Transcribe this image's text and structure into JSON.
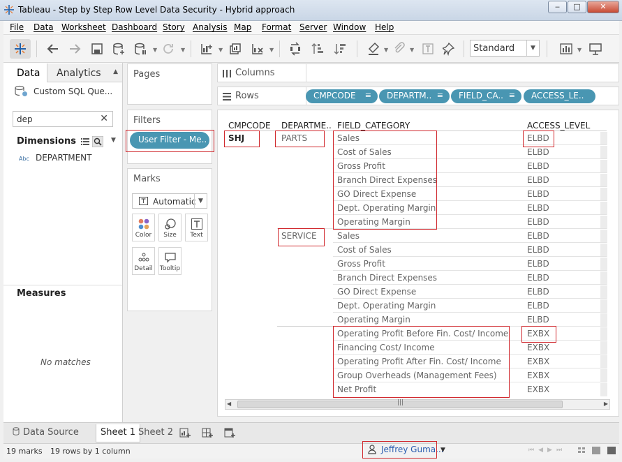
{
  "window": {
    "title": "Tableau - Step by Step Row Level Data Security - Hybrid approach",
    "minimize": "‒",
    "maximize": "□",
    "close": "✕"
  },
  "menu": [
    "File",
    "Data",
    "Worksheet",
    "Dashboard",
    "Story",
    "Analysis",
    "Map",
    "Format",
    "Server",
    "Window",
    "Help"
  ],
  "toolbar": {
    "fit_select": "Standard",
    "icons": [
      "tableau-logo-icon",
      "undo-icon",
      "redo-icon",
      "save-icon",
      "new-datasource-icon",
      "pause-updates-icon",
      "refresh-icon",
      "new-worksheet-icon",
      "duplicate-sheet-icon",
      "clear-sheet-icon",
      "swap-rows-columns-icon",
      "sort-ascending-icon",
      "sort-descending-icon",
      "highlight-icon",
      "group-icon",
      "labels-icon",
      "fix-axes-icon",
      "show-me-icon",
      "presentation-icon"
    ]
  },
  "data_pane": {
    "tab_data": "Data",
    "tab_analytics": "Analytics",
    "datasource": "Custom SQL Que...",
    "search_value": "dep",
    "dimensions_header": "Dimensions",
    "dimension_type": "Abc",
    "dimension_item": "DEPARTMENT",
    "measures_header": "Measures",
    "measures_empty": "No matches"
  },
  "cards": {
    "pages": "Pages",
    "filters": "Filters",
    "filter_pill": "User Filter - Me..",
    "marks": "Marks",
    "mark_type": "Automatic",
    "mark_buttons": [
      "Color",
      "Size",
      "Text",
      "Detail",
      "Tooltip"
    ]
  },
  "shelves": {
    "columns_label": "Columns",
    "rows_label": "Rows",
    "row_pills": [
      "CMPCODE",
      "DEPARTM..",
      "FIELD_CA..",
      "ACCESS_LE.."
    ]
  },
  "view": {
    "headers": [
      "CMPCODE",
      "DEPARTME..",
      "FIELD_CATEGORY",
      "ACCESS_LEVEL"
    ],
    "cmpcode": "SHJ",
    "departments": [
      "PARTS",
      "SERVICE"
    ],
    "rows": [
      {
        "field": "Sales",
        "access": "ELBD"
      },
      {
        "field": "Cost of Sales",
        "access": "ELBD"
      },
      {
        "field": "Gross Profit",
        "access": "ELBD"
      },
      {
        "field": "Branch Direct Expenses",
        "access": "ELBD"
      },
      {
        "field": "GO Direct Expense",
        "access": "ELBD"
      },
      {
        "field": "Dept. Operating Margin",
        "access": "ELBD"
      },
      {
        "field": "Operating Margin",
        "access": "ELBD"
      },
      {
        "field": "Sales",
        "access": "ELBD"
      },
      {
        "field": "Cost of Sales",
        "access": "ELBD"
      },
      {
        "field": "Gross Profit",
        "access": "ELBD"
      },
      {
        "field": "Branch Direct Expenses",
        "access": "ELBD"
      },
      {
        "field": "GO Direct Expense",
        "access": "ELBD"
      },
      {
        "field": "Dept. Operating Margin",
        "access": "ELBD"
      },
      {
        "field": "Operating Margin",
        "access": "ELBD"
      },
      {
        "field": "Operating Profit Before Fin. Cost/ Income",
        "access": "EXBX"
      },
      {
        "field": "Financing Cost/ Income",
        "access": "EXBX"
      },
      {
        "field": "Operating Profit After Fin. Cost/ Income",
        "access": "EXBX"
      },
      {
        "field": "Group Overheads (Management Fees)",
        "access": "EXBX"
      },
      {
        "field": "Net Profit",
        "access": "EXBX"
      }
    ]
  },
  "tabs": {
    "data_source": "Data Source",
    "sheet1": "Sheet 1",
    "sheet2": "Sheet 2"
  },
  "status": {
    "marks": "19 marks",
    "rows_cols": "19 rows by 1 column",
    "user": "Jeffrey Guma..."
  },
  "colors": {
    "pill": "#4996b2",
    "highlight_box": "#d0282d",
    "user_link": "#2a5db0"
  }
}
